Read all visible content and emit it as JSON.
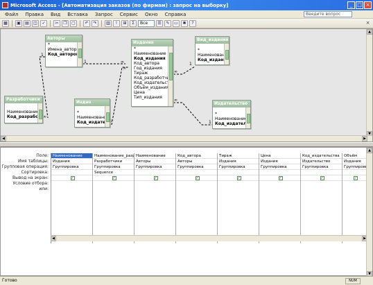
{
  "titlebar": {
    "title": "Microsoft Access - [Автоматизация заказов (по фирмам) : запрос на выборку]",
    "minimize": "_",
    "maximize": "□",
    "close": "×"
  },
  "menubar": {
    "items": [
      "Файл",
      "Правка",
      "Вид",
      "Вставка",
      "Запрос",
      "Сервис",
      "Окно",
      "Справка"
    ],
    "help_placeholder": "Введите вопрос"
  },
  "toolbar": {
    "all_combo": "Все",
    "mdi_close": "×"
  },
  "tables": {
    "avtory": {
      "title": "Авторы",
      "fields": [
        "*",
        "Имена_авторов",
        "Код_авторов"
      ]
    },
    "razrabotchik": {
      "title": "Разработчики",
      "fields": [
        "Наименование_разр",
        "Код_разработчик"
      ]
    },
    "izdan": {
      "title": "Издан",
      "fields": [
        "*",
        "Наименование",
        "Код_издательства"
      ]
    },
    "izdanie": {
      "title": "Издания",
      "fields": [
        "*",
        "Наименование",
        "Код_издания",
        "Код_автора",
        "Год_издания",
        "Тираж",
        "Код_разработчика",
        "Код_издательства",
        "Объём_издания",
        "Цена",
        "Тип_издания"
      ]
    },
    "vid_izdaniya": {
      "title": "Вид_издания",
      "fields": [
        "*",
        "Наименование",
        "Код_издания"
      ]
    },
    "izdatelstvo": {
      "title": "Издательство",
      "fields": [
        "*",
        "Наименование",
        "Код_издательства"
      ]
    }
  },
  "grid": {
    "row_labels": [
      "Поле:",
      "Имя таблицы:",
      "Групповая операция:",
      "Сортировка:",
      "Вывод на экран:",
      "Условие отбора:",
      "или:"
    ],
    "columns": [
      {
        "field": "Наименование",
        "table": "Издания",
        "group": "Группировка",
        "sort": "",
        "show": true,
        "selected": true
      },
      {
        "field": "Наименование_разр",
        "table": "Разработчики",
        "group": "Группировка",
        "sort": "Sequence",
        "show": true
      },
      {
        "field": "Наименование",
        "table": "Авторы",
        "group": "Группировка",
        "sort": "",
        "show": true
      },
      {
        "field": "Код_автора",
        "table": "Авторы",
        "group": "Группировка",
        "sort": "",
        "show": true
      },
      {
        "field": "Тираж",
        "table": "Издания",
        "group": "Группировка",
        "sort": "",
        "show": true
      },
      {
        "field": "Цена",
        "table": "Издания",
        "group": "Группировка",
        "sort": "",
        "show": true
      },
      {
        "field": "Код_издательства",
        "table": "Издательство",
        "group": "Группировка",
        "sort": "",
        "show": true
      },
      {
        "field": "Объём",
        "table": "Издания",
        "group": "Группировка",
        "sort": "",
        "show": true
      }
    ]
  },
  "statusbar": {
    "text": "Готово",
    "indicator": "NUM"
  }
}
